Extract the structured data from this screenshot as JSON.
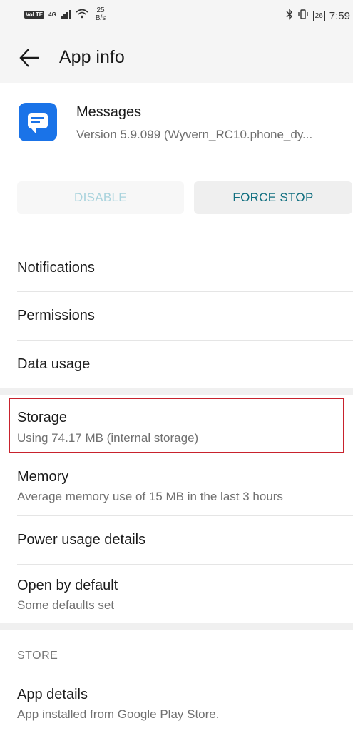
{
  "status_bar": {
    "volte": "VoLTE",
    "network": "4G",
    "speed_value": "25",
    "speed_unit": "B/s",
    "battery": "26",
    "time": "7:59"
  },
  "header": {
    "title": "App info"
  },
  "app": {
    "name": "Messages",
    "version": "Version 5.9.099 (Wyvern_RC10.phone_dy..."
  },
  "buttons": {
    "disable": "DISABLE",
    "force_stop": "FORCE STOP"
  },
  "items": {
    "notifications": {
      "title": "Notifications"
    },
    "permissions": {
      "title": "Permissions"
    },
    "data_usage": {
      "title": "Data usage"
    },
    "storage": {
      "title": "Storage",
      "subtitle": "Using 74.17 MB (internal storage)"
    },
    "memory": {
      "title": "Memory",
      "subtitle": "Average memory use of 15 MB in the last 3 hours"
    },
    "power": {
      "title": "Power usage details"
    },
    "open_default": {
      "title": "Open by default",
      "subtitle": "Some defaults set"
    }
  },
  "store": {
    "section_label": "STORE",
    "app_details": {
      "title": "App details",
      "subtitle": "App installed from Google Play Store."
    }
  }
}
